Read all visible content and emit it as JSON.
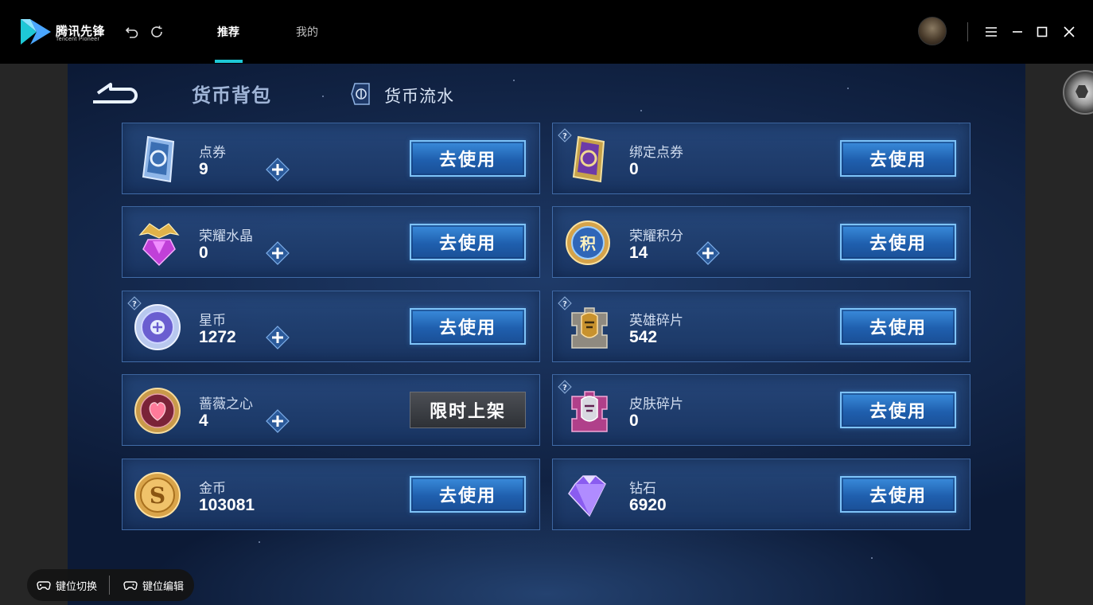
{
  "app": {
    "logo_text": "腾讯先锋",
    "logo_sub": "Tencent Pioneer"
  },
  "nav": {
    "tabs": [
      {
        "label": "推荐",
        "active": true
      },
      {
        "label": "我的",
        "active": false
      }
    ],
    "accent_color": "#1ec8d6"
  },
  "window_controls": [
    "menu-icon",
    "minimize-icon",
    "maximize-icon",
    "close-icon"
  ],
  "page": {
    "title": "货币背包",
    "ledger_tab": "货币流水"
  },
  "currencies": [
    {
      "name": "点券",
      "value": "9",
      "plus": true,
      "help": false,
      "action": "去使用",
      "icon": "voucher-card-icon"
    },
    {
      "name": "绑定点券",
      "value": "0",
      "plus": false,
      "help": true,
      "action": "去使用",
      "icon": "bound-voucher-card-icon"
    },
    {
      "name": "荣耀水晶",
      "value": "0",
      "plus": true,
      "help": false,
      "action": "去使用",
      "icon": "glory-crystal-icon"
    },
    {
      "name": "荣耀积分",
      "value": "14",
      "plus": true,
      "help": false,
      "action": "去使用",
      "icon": "glory-points-icon"
    },
    {
      "name": "星币",
      "value": "1272",
      "plus": true,
      "help": true,
      "action": "去使用",
      "icon": "star-coin-icon"
    },
    {
      "name": "英雄碎片",
      "value": "542",
      "plus": false,
      "help": true,
      "action": "去使用",
      "icon": "hero-shard-icon"
    },
    {
      "name": "蔷薇之心",
      "value": "4",
      "plus": true,
      "help": false,
      "action": "限时上架",
      "action_disabled": true,
      "icon": "rose-heart-icon"
    },
    {
      "name": "皮肤碎片",
      "value": "0",
      "plus": false,
      "help": true,
      "action": "去使用",
      "icon": "skin-shard-icon"
    },
    {
      "name": "金币",
      "value": "103081",
      "plus": false,
      "help": false,
      "action": "去使用",
      "icon": "gold-coin-icon"
    },
    {
      "name": "钻石",
      "value": "6920",
      "plus": false,
      "help": false,
      "action": "去使用",
      "icon": "diamond-icon"
    }
  ],
  "keymap": {
    "switch_label": "键位切换",
    "edit_label": "键位编辑"
  }
}
